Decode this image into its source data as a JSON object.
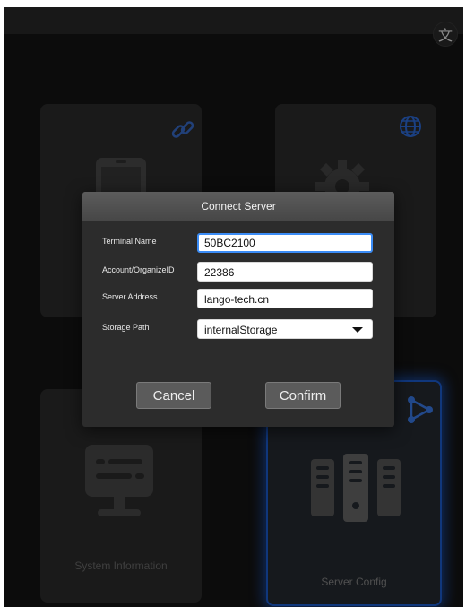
{
  "translate_button": {
    "glyph": "文"
  },
  "cards": [
    {
      "name": "connect",
      "label": "",
      "icon": "link-icon",
      "image": "phone-icon"
    },
    {
      "name": "settings",
      "label": "",
      "icon": "globe-icon",
      "image": "gear-icon"
    },
    {
      "name": "system-information",
      "label": "System Information",
      "icon": "",
      "image": "monitor-icon"
    },
    {
      "name": "server-config",
      "label": "Server Config",
      "icon": "share-icon",
      "image": "server-rack-icon",
      "selected": true
    }
  ],
  "dialog": {
    "title": "Connect Server",
    "fields": {
      "terminal_name": {
        "label": "Terminal Name",
        "value": "50BC2100"
      },
      "account": {
        "label": "Account/OrganizeID",
        "value": "22386"
      },
      "server_address": {
        "label": "Server Address",
        "value": "lango-tech.cn"
      },
      "storage_path": {
        "label": "Storage Path",
        "value": "internalStorage"
      }
    },
    "cancel_label": "Cancel",
    "confirm_label": "Confirm"
  },
  "colors": {
    "accent": "#1d5fd6",
    "focus_border": "#3b8cf5",
    "background": "#151515"
  }
}
